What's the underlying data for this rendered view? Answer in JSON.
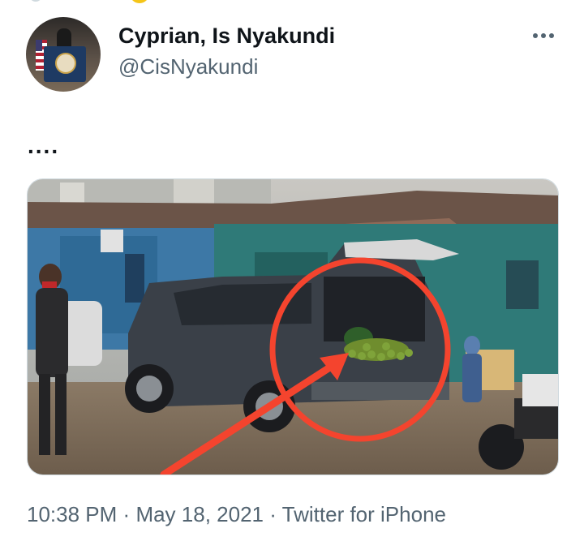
{
  "author": {
    "display_name": "Cyprian, Is Nyakundi",
    "handle": "@CisNyakundi",
    "avatar_icon": "avatar-podium-image"
  },
  "tweet": {
    "text": "....",
    "more_icon": "more-horizontal-icon"
  },
  "media": {
    "kind": "photo",
    "icon": "annotated-photo"
  },
  "meta": {
    "time": "10:38 PM",
    "separator": "·",
    "date": "May 18, 2021",
    "source": "Twitter for iPhone"
  },
  "colors": {
    "text_primary": "#0f1419",
    "text_secondary": "#536471",
    "annotation_red": "#f4442e"
  }
}
